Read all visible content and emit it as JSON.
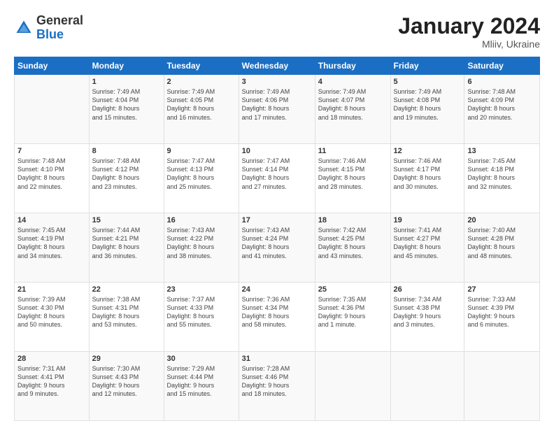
{
  "header": {
    "logo_general": "General",
    "logo_blue": "Blue",
    "title": "January 2024",
    "subtitle": "Mliiv, Ukraine"
  },
  "days_of_week": [
    "Sunday",
    "Monday",
    "Tuesday",
    "Wednesday",
    "Thursday",
    "Friday",
    "Saturday"
  ],
  "weeks": [
    [
      {
        "day": "",
        "info": ""
      },
      {
        "day": "1",
        "info": "Sunrise: 7:49 AM\nSunset: 4:04 PM\nDaylight: 8 hours\nand 15 minutes."
      },
      {
        "day": "2",
        "info": "Sunrise: 7:49 AM\nSunset: 4:05 PM\nDaylight: 8 hours\nand 16 minutes."
      },
      {
        "day": "3",
        "info": "Sunrise: 7:49 AM\nSunset: 4:06 PM\nDaylight: 8 hours\nand 17 minutes."
      },
      {
        "day": "4",
        "info": "Sunrise: 7:49 AM\nSunset: 4:07 PM\nDaylight: 8 hours\nand 18 minutes."
      },
      {
        "day": "5",
        "info": "Sunrise: 7:49 AM\nSunset: 4:08 PM\nDaylight: 8 hours\nand 19 minutes."
      },
      {
        "day": "6",
        "info": "Sunrise: 7:48 AM\nSunset: 4:09 PM\nDaylight: 8 hours\nand 20 minutes."
      }
    ],
    [
      {
        "day": "7",
        "info": "Sunrise: 7:48 AM\nSunset: 4:10 PM\nDaylight: 8 hours\nand 22 minutes."
      },
      {
        "day": "8",
        "info": "Sunrise: 7:48 AM\nSunset: 4:12 PM\nDaylight: 8 hours\nand 23 minutes."
      },
      {
        "day": "9",
        "info": "Sunrise: 7:47 AM\nSunset: 4:13 PM\nDaylight: 8 hours\nand 25 minutes."
      },
      {
        "day": "10",
        "info": "Sunrise: 7:47 AM\nSunset: 4:14 PM\nDaylight: 8 hours\nand 27 minutes."
      },
      {
        "day": "11",
        "info": "Sunrise: 7:46 AM\nSunset: 4:15 PM\nDaylight: 8 hours\nand 28 minutes."
      },
      {
        "day": "12",
        "info": "Sunrise: 7:46 AM\nSunset: 4:17 PM\nDaylight: 8 hours\nand 30 minutes."
      },
      {
        "day": "13",
        "info": "Sunrise: 7:45 AM\nSunset: 4:18 PM\nDaylight: 8 hours\nand 32 minutes."
      }
    ],
    [
      {
        "day": "14",
        "info": "Sunrise: 7:45 AM\nSunset: 4:19 PM\nDaylight: 8 hours\nand 34 minutes."
      },
      {
        "day": "15",
        "info": "Sunrise: 7:44 AM\nSunset: 4:21 PM\nDaylight: 8 hours\nand 36 minutes."
      },
      {
        "day": "16",
        "info": "Sunrise: 7:43 AM\nSunset: 4:22 PM\nDaylight: 8 hours\nand 38 minutes."
      },
      {
        "day": "17",
        "info": "Sunrise: 7:43 AM\nSunset: 4:24 PM\nDaylight: 8 hours\nand 41 minutes."
      },
      {
        "day": "18",
        "info": "Sunrise: 7:42 AM\nSunset: 4:25 PM\nDaylight: 8 hours\nand 43 minutes."
      },
      {
        "day": "19",
        "info": "Sunrise: 7:41 AM\nSunset: 4:27 PM\nDaylight: 8 hours\nand 45 minutes."
      },
      {
        "day": "20",
        "info": "Sunrise: 7:40 AM\nSunset: 4:28 PM\nDaylight: 8 hours\nand 48 minutes."
      }
    ],
    [
      {
        "day": "21",
        "info": "Sunrise: 7:39 AM\nSunset: 4:30 PM\nDaylight: 8 hours\nand 50 minutes."
      },
      {
        "day": "22",
        "info": "Sunrise: 7:38 AM\nSunset: 4:31 PM\nDaylight: 8 hours\nand 53 minutes."
      },
      {
        "day": "23",
        "info": "Sunrise: 7:37 AM\nSunset: 4:33 PM\nDaylight: 8 hours\nand 55 minutes."
      },
      {
        "day": "24",
        "info": "Sunrise: 7:36 AM\nSunset: 4:34 PM\nDaylight: 8 hours\nand 58 minutes."
      },
      {
        "day": "25",
        "info": "Sunrise: 7:35 AM\nSunset: 4:36 PM\nDaylight: 9 hours\nand 1 minute."
      },
      {
        "day": "26",
        "info": "Sunrise: 7:34 AM\nSunset: 4:38 PM\nDaylight: 9 hours\nand 3 minutes."
      },
      {
        "day": "27",
        "info": "Sunrise: 7:33 AM\nSunset: 4:39 PM\nDaylight: 9 hours\nand 6 minutes."
      }
    ],
    [
      {
        "day": "28",
        "info": "Sunrise: 7:31 AM\nSunset: 4:41 PM\nDaylight: 9 hours\nand 9 minutes."
      },
      {
        "day": "29",
        "info": "Sunrise: 7:30 AM\nSunset: 4:43 PM\nDaylight: 9 hours\nand 12 minutes."
      },
      {
        "day": "30",
        "info": "Sunrise: 7:29 AM\nSunset: 4:44 PM\nDaylight: 9 hours\nand 15 minutes."
      },
      {
        "day": "31",
        "info": "Sunrise: 7:28 AM\nSunset: 4:46 PM\nDaylight: 9 hours\nand 18 minutes."
      },
      {
        "day": "",
        "info": ""
      },
      {
        "day": "",
        "info": ""
      },
      {
        "day": "",
        "info": ""
      }
    ]
  ]
}
